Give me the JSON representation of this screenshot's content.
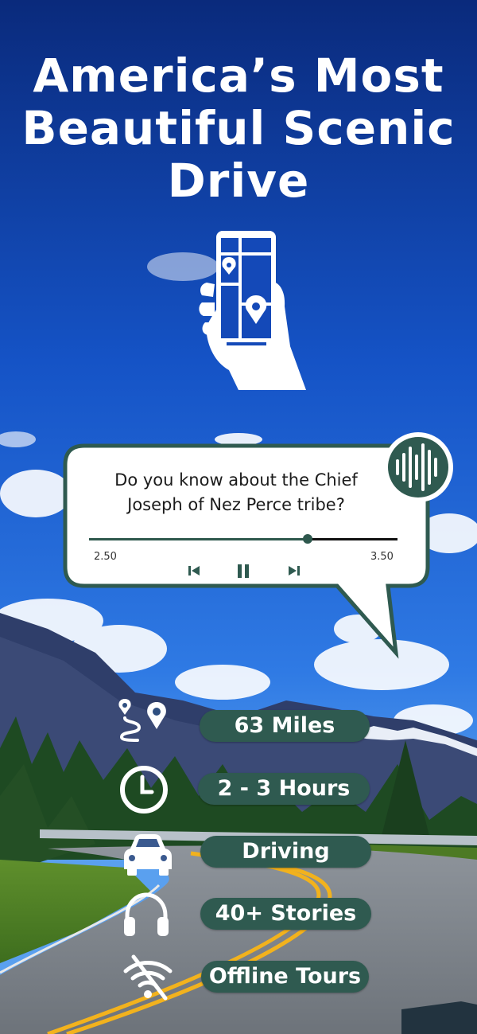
{
  "headline": {
    "line1": "America’s Most",
    "line2": "Beautiful Scenic",
    "line3": "Drive"
  },
  "illustration": {
    "icon": "phone-map-pin-icon"
  },
  "audio_card": {
    "question_line1": "Do you know about the Chief",
    "question_line2": "Joseph of Nez Perce tribe?",
    "time_start": "2.50",
    "time_end": "3.50",
    "progress": 0.71,
    "controls": [
      "skip-back-icon",
      "pause-icon",
      "skip-forward-icon"
    ],
    "badge_icon": "sound-wave-icon"
  },
  "stats": [
    {
      "icon": "route-pin-icon",
      "label": "63 Miles"
    },
    {
      "icon": "clock-icon",
      "label": "2 - 3 Hours"
    },
    {
      "icon": "car-icon",
      "label": "Driving"
    },
    {
      "icon": "headphones-icon",
      "label": "40+ Stories"
    },
    {
      "icon": "no-wifi-icon",
      "label": "Offline Tours"
    }
  ],
  "colors": {
    "accent": "#2f5a50",
    "sky_top": "#0b2f86",
    "sky_mid": "#1a5bd3",
    "road_line": "#f2b21d"
  }
}
